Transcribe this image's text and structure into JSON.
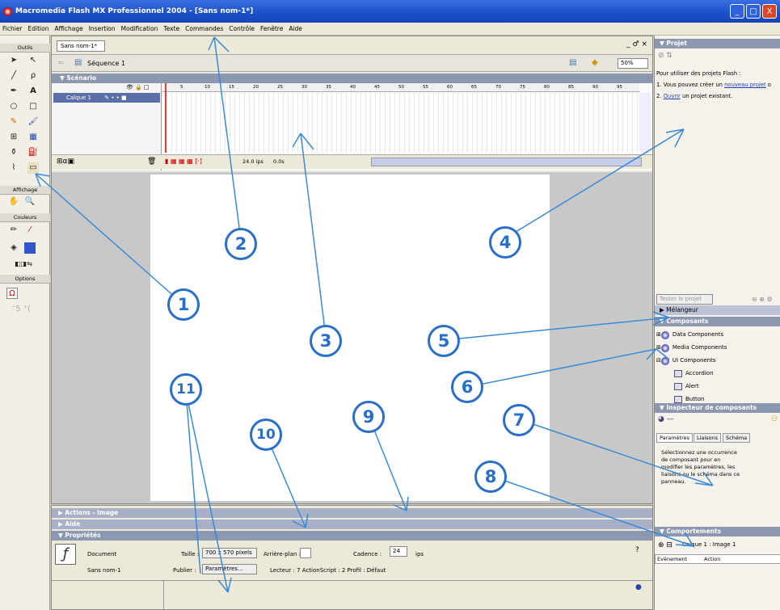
{
  "window": {
    "title": "Macromedia Flash MX Professionnel 2004 - [Sans nom-1*]",
    "buttons": [
      "_",
      "□",
      "X"
    ]
  },
  "menu": [
    "Fichier",
    "Edition",
    "Affichage",
    "Insertion",
    "Modification",
    "Texte",
    "Commandes",
    "Contrôle",
    "Fenêtre",
    "Aide"
  ],
  "tools": {
    "title": "Outils",
    "affichage": "Affichage",
    "couleurs": "Couleurs",
    "options": "Options"
  },
  "document": {
    "tab": "Sans nom-1*",
    "window_controls": "_ ♂ ×",
    "scene": "Séquence 1",
    "zoom": "50%"
  },
  "timeline": {
    "title": "Scénario",
    "layer": "Calque 1",
    "frame_numbers": [
      "5",
      "10",
      "15",
      "20",
      "25",
      "30",
      "35",
      "40",
      "45",
      "50",
      "55",
      "60",
      "65",
      "70",
      "75",
      "80",
      "85",
      "90",
      "95"
    ],
    "fps": "24.0 ips",
    "time": "0.0s"
  },
  "properties": {
    "actions": "Actions - Image",
    "aide": "Aide",
    "title": "Propriétés",
    "doc_label": "Document",
    "doc_name": "Sans nom-1",
    "size_label": "Taille :",
    "size_value": "700 x 570 pixels",
    "bg_label": "Arrière-plan :",
    "rate_label": "Cadence :",
    "rate_value": "24",
    "rate_unit": "ips",
    "publish_label": "Publier :",
    "publish_button": "Paramètres...",
    "player_info": "Lecteur : 7   ActionScript : 2   Profil : Défaut"
  },
  "project": {
    "title": "Projet",
    "intro": "Pour utiliser des projets Flash :",
    "line1_pre": "1. Vous pouvez créer un ",
    "line1_link": "nouveau projet",
    "line1_post": " o",
    "line2_pre": "2. ",
    "line2_link": "Ouvrir",
    "line2_post": " un projet existant.",
    "test_button": "Tester le projet"
  },
  "melangeur": "Mélangeur",
  "composants": {
    "title": "Composants",
    "items": [
      "Data Components",
      "Media Components",
      "UI Components",
      "Accordion",
      "Alert",
      "Button"
    ]
  },
  "inspector": {
    "title": "Inspecteur de composants",
    "tabs": [
      "Paramètres",
      "Liaisons",
      "Schéma"
    ],
    "text": "Sélectionnez une occurrence de composant pour en modifier les paramètres, les liaisons ou le schéma dans ce panneau."
  },
  "comportements": {
    "title": "Comportements",
    "context": "Calque 1 : Image 1",
    "cols": [
      "Evénement",
      "Action"
    ]
  },
  "callouts": [
    "1",
    "2",
    "3",
    "4",
    "5",
    "6",
    "7",
    "8",
    "9",
    "10",
    "11"
  ],
  "colors": {
    "callout": "#2a6fc7",
    "panel_header": "#8c97b0",
    "title_blue": "#1b4fc9"
  }
}
